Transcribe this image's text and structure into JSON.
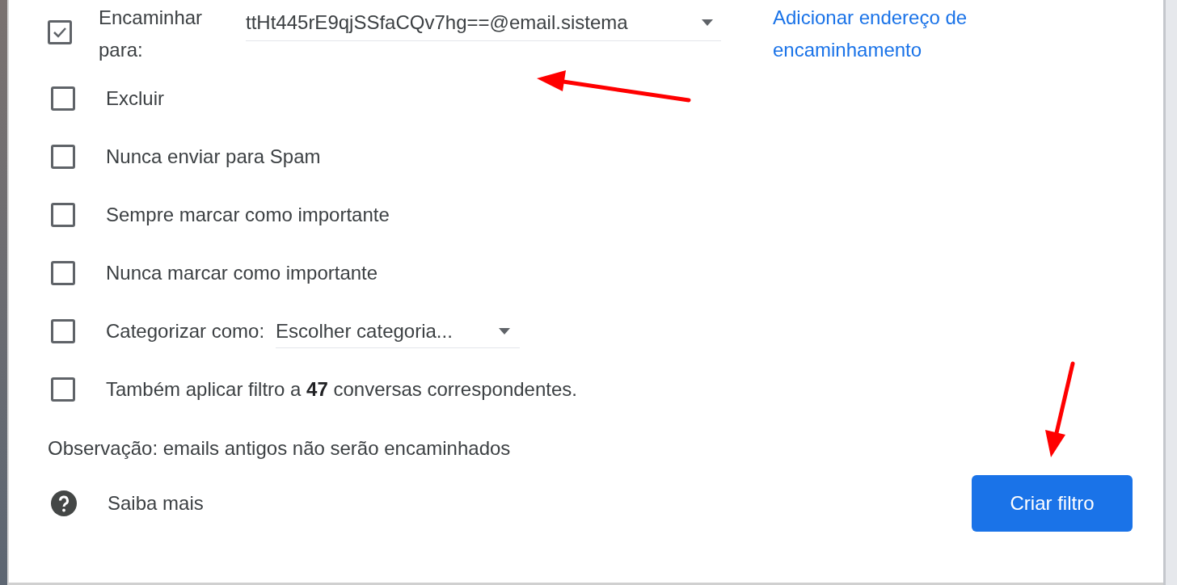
{
  "forward": {
    "checked": true,
    "label": "Encaminhar para:",
    "address": "ttHt445rE9qjSSfaCQv7hg==@email.sistema",
    "add_link": "Adicionar endereço de encaminhamento"
  },
  "actions": [
    {
      "kind": "checkbox",
      "label": "Excluir",
      "checked": false
    },
    {
      "kind": "checkbox",
      "label": "Nunca enviar para Spam",
      "checked": false
    },
    {
      "kind": "checkbox",
      "label": "Sempre marcar como importante",
      "checked": false
    },
    {
      "kind": "checkbox",
      "label": "Nunca marcar como importante",
      "checked": false
    },
    {
      "kind": "select",
      "label": "Categorizar como:",
      "checked": false,
      "placeholder": "Escolher categoria..."
    },
    {
      "kind": "checkbox",
      "label": "Também aplicar filtro a **47** conversas correspondentes.",
      "checked": false
    }
  ],
  "note": "Observação: emails antigos não serão encaminhados",
  "help_link": "Saiba mais",
  "create_button": "Criar filtro"
}
